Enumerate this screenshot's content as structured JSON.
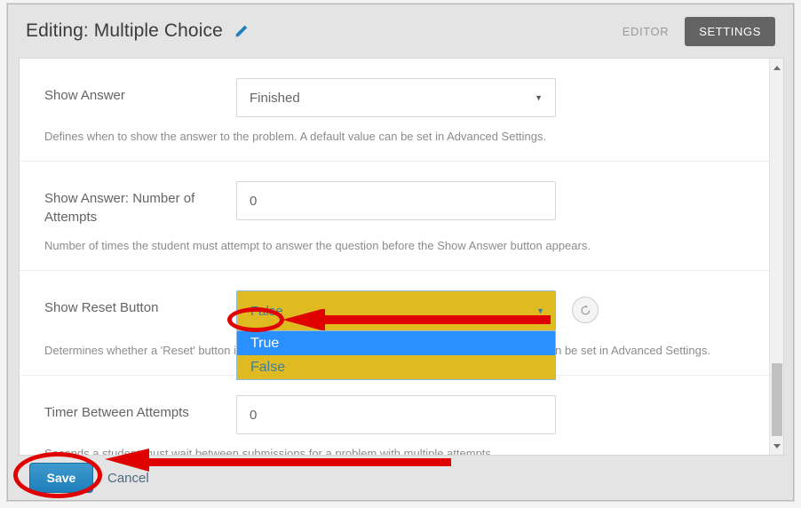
{
  "header": {
    "title": "Editing: Multiple Choice",
    "pencil_icon": "pencil-icon",
    "tab_editor": "EDITOR",
    "tab_settings": "SETTINGS"
  },
  "settings": [
    {
      "label": "Show Answer",
      "control_type": "select",
      "value": "Finished",
      "help": "Defines when to show the answer to the problem. A default value can be set in Advanced Settings."
    },
    {
      "label": "Show Answer: Number of Attempts",
      "control_type": "input",
      "value": "0",
      "help": "Number of times the student must attempt to answer the question before the Show Answer button appears."
    },
    {
      "label": "Show Reset Button",
      "control_type": "select-open",
      "value": "False",
      "options": [
        "True",
        "False"
      ],
      "selected_option": "True",
      "help": "Determines whether a 'Reset' button is shown so the user may reset their answer. A default value can be set in Advanced Settings.",
      "reset_icon": "revert-icon"
    },
    {
      "label": "Timer Between Attempts",
      "control_type": "input",
      "value": "0",
      "help": "Seconds a student must wait between submissions for a problem with multiple attempts."
    }
  ],
  "footer": {
    "save_label": "Save",
    "cancel_label": "Cancel"
  },
  "scrollbar": {
    "up_icon": "scroll-up-icon",
    "down_icon": "scroll-down-icon",
    "thumb": "scroll-thumb"
  },
  "annotations": {
    "highlight_color": "#e00000",
    "dropdown_highlight_color": "#e0ba21",
    "option_selected_color": "#2a8fff"
  }
}
